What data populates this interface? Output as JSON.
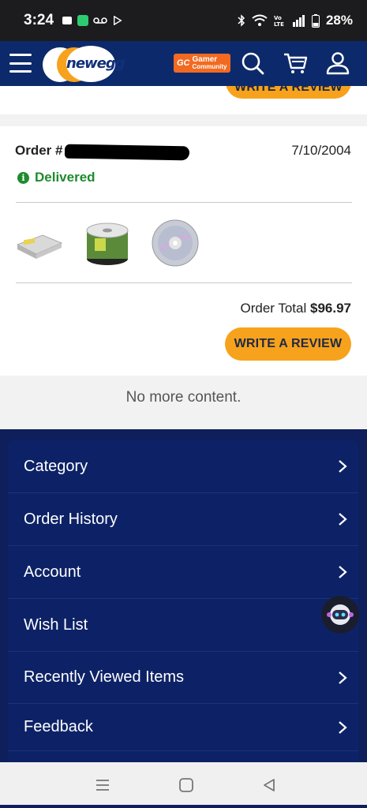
{
  "status_bar": {
    "time": "3:24",
    "battery": "28%"
  },
  "header": {
    "logo_text": "newegg",
    "gamer_badge_line1": "Gamer",
    "gamer_badge_line2": "Community",
    "gamer_badge_logo": "GC"
  },
  "previous_order": {
    "review_label": "WRITE A REVIEW"
  },
  "order": {
    "label": "Order #",
    "date": "7/10/2004",
    "status": "Delivered",
    "total_label": "Order Total",
    "total_value": "$96.97",
    "review_label": "WRITE A REVIEW",
    "products": [
      {
        "name": "optical-drive"
      },
      {
        "name": "disc-spindle"
      },
      {
        "name": "cd-disc"
      }
    ]
  },
  "no_more_text": "No more content.",
  "menu": {
    "items": [
      {
        "label": "Category",
        "chevron": true
      },
      {
        "label": "Order History",
        "chevron": true
      },
      {
        "label": "Account",
        "chevron": true
      },
      {
        "label": "Wish List",
        "chevron": false
      },
      {
        "label": "Recently Viewed Items",
        "chevron": true
      },
      {
        "label": "Feedback",
        "chevron": true
      }
    ]
  },
  "colors": {
    "header_bg": "#0c2a6b",
    "accent_orange": "#f7a21c",
    "delivered_green": "#1e8b2e",
    "footer_bg": "#0f1f5c"
  }
}
